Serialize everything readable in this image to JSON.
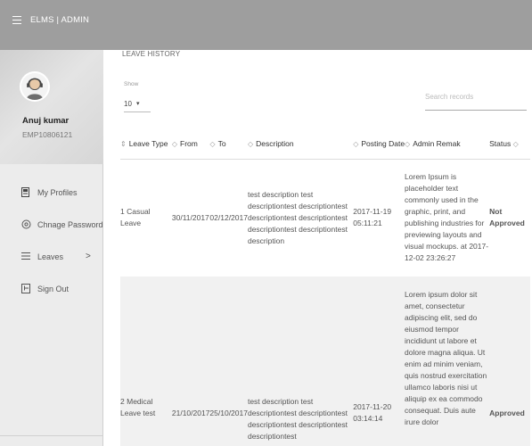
{
  "app": {
    "title": "ELMS | ADMIN"
  },
  "profile": {
    "name": "Anuj kumar",
    "emp_id": "EMP10806121"
  },
  "sidebar": {
    "items": [
      {
        "label": "My Profiles",
        "icon": "person-badge-icon"
      },
      {
        "label": "Chnage Password",
        "icon": "settings-icon"
      },
      {
        "label": "Leaves",
        "icon": "list-icon",
        "chevron": ">"
      },
      {
        "label": "Sign Out",
        "icon": "signout-icon"
      }
    ]
  },
  "main": {
    "section_title": "LEAVE HISTORY",
    "show_label": "Show",
    "show_value": "10",
    "show_caret": "▾",
    "search_placeholder": "Search records"
  },
  "table": {
    "columns": [
      "Leave Type",
      "From",
      "To",
      "Description",
      "Posting Date",
      "Admin Remak",
      "Status"
    ],
    "first_col_sort": "⇕",
    "sort_symbol": "◇",
    "rows": [
      {
        "num": "1",
        "leave_type": "Casual Leave",
        "from": "30/11/2017",
        "to": "02/12/2017",
        "description": "test description test descriptiontest descriptiontest descriptiontest descriptiontest descriptiontest descriptiontest description",
        "posting_date": "2017-11-19 05:11:21",
        "admin_remark": "Lorem Ipsum is placeholder text commonly used in the graphic, print, and publishing industries for previewing layouts and visual mockups. at 2017-12-02 23:26:27",
        "status": "Not Approved"
      },
      {
        "num": "2",
        "leave_type": "Medical Leave test",
        "from": "21/10/2017",
        "to": "25/10/2017",
        "description": "test description test descriptiontest descriptiontest descriptiontest descriptiontest descriptiontest",
        "posting_date": "2017-11-20 03:14:14",
        "admin_remark": "Lorem ipsum dolor sit amet, consectetur adipiscing elit, sed do eiusmod tempor incididunt ut labore et dolore magna aliqua. Ut enim ad minim veniam, quis nostrud exercitation ullamco laboris nisi ut aliquip ex ea commodo consequat. Duis aute irure dolor",
        "status": "Approved"
      }
    ]
  }
}
